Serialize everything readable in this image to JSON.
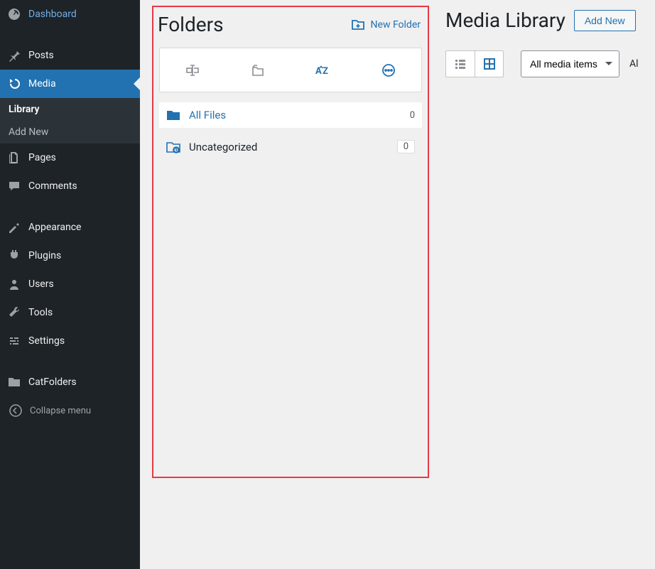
{
  "sidebar": {
    "items": [
      {
        "label": "Dashboard"
      },
      {
        "label": "Posts"
      },
      {
        "label": "Media"
      },
      {
        "label": "Pages"
      },
      {
        "label": "Comments"
      },
      {
        "label": "Appearance"
      },
      {
        "label": "Plugins"
      },
      {
        "label": "Users"
      },
      {
        "label": "Tools"
      },
      {
        "label": "Settings"
      },
      {
        "label": "CatFolders"
      }
    ],
    "submenu": {
      "library": "Library",
      "add_new": "Add New"
    },
    "collapse": "Collapse menu"
  },
  "folders": {
    "title": "Folders",
    "new_folder": "New Folder",
    "items": [
      {
        "label": "All Files",
        "count": "0"
      },
      {
        "label": "Uncategorized",
        "count": "0"
      }
    ]
  },
  "media_library": {
    "title": "Media Library",
    "add_new": "Add New",
    "filter_selected": "All media items",
    "filter_cut": "Al"
  }
}
